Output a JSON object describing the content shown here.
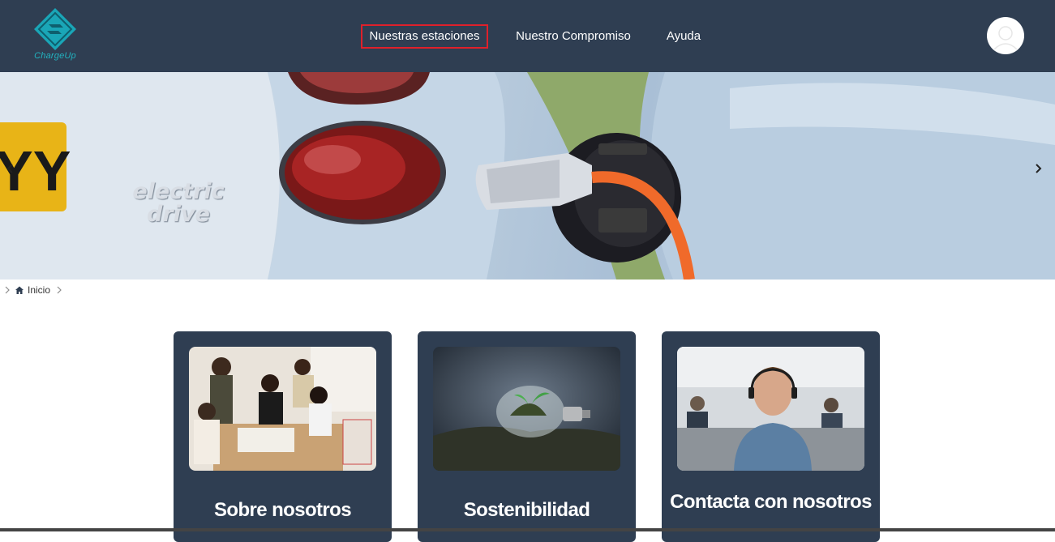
{
  "brand": {
    "name": "ChargeUp",
    "accent": "#22b3c0"
  },
  "nav": {
    "items": [
      {
        "label": "Nuestras estaciones",
        "active": true
      },
      {
        "label": "Nuestro Compromiso",
        "active": false
      },
      {
        "label": "Ayuda",
        "active": false
      }
    ]
  },
  "hero": {
    "badge_line1": "electric",
    "badge_line2": "drive",
    "plate_text": "YY",
    "prev_icon": "chevron-left-icon",
    "next_icon": "chevron-right-icon"
  },
  "breadcrumb": {
    "home_label": "Inicio"
  },
  "cards": [
    {
      "title": "Sobre nosotros"
    },
    {
      "title": "Sostenibilidad"
    },
    {
      "title": "Contacta con nosotros"
    }
  ],
  "colors": {
    "header_bg": "#2f3e52",
    "card_bg": "#2f3e52",
    "active_outline": "#e0202a"
  }
}
